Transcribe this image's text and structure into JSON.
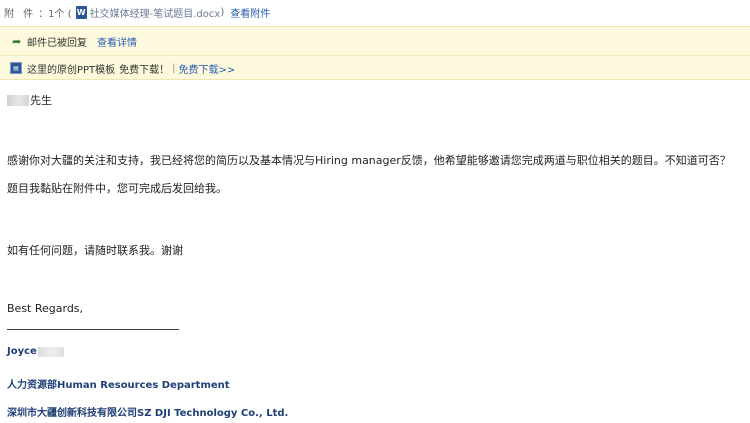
{
  "attachment": {
    "label": "附 件",
    "count": "：1个 (",
    "icon": "W",
    "filename": "社交媒体经理-笔试题目.docx",
    "close_paren": ")",
    "view_link": "查看附件"
  },
  "notice": {
    "reply_text": "邮件已被回复",
    "detail_link": "查看详情",
    "ad_text": "这里的原创PPT模板",
    "ad_download": "免费下载！",
    "ad_sep": "|",
    "ad_link": "免费下载>>"
  },
  "email": {
    "greeting": "先生",
    "para1": "感谢你对大疆的关注和支持，我已经将您的简历以及基本情况与Hiring manager反馈，他希望能够邀请您完成两道与职位相关的题目。不知道可否？",
    "para2": "题目我黏贴在附件中，您可完成后发回给我。",
    "para3": "如有任何问题，请随时联系我。谢谢",
    "regards": "Best Regards,"
  },
  "signature": {
    "name": "Joyce",
    "department": "人力资源部Human Resources Department",
    "company": "深圳市大疆创新科技有限公司SZ DJI Technology Co., Ltd."
  },
  "colors": {
    "link": "#2a5db0",
    "notice_bg": "#fdf9dc",
    "signature": "#1f3f78"
  }
}
